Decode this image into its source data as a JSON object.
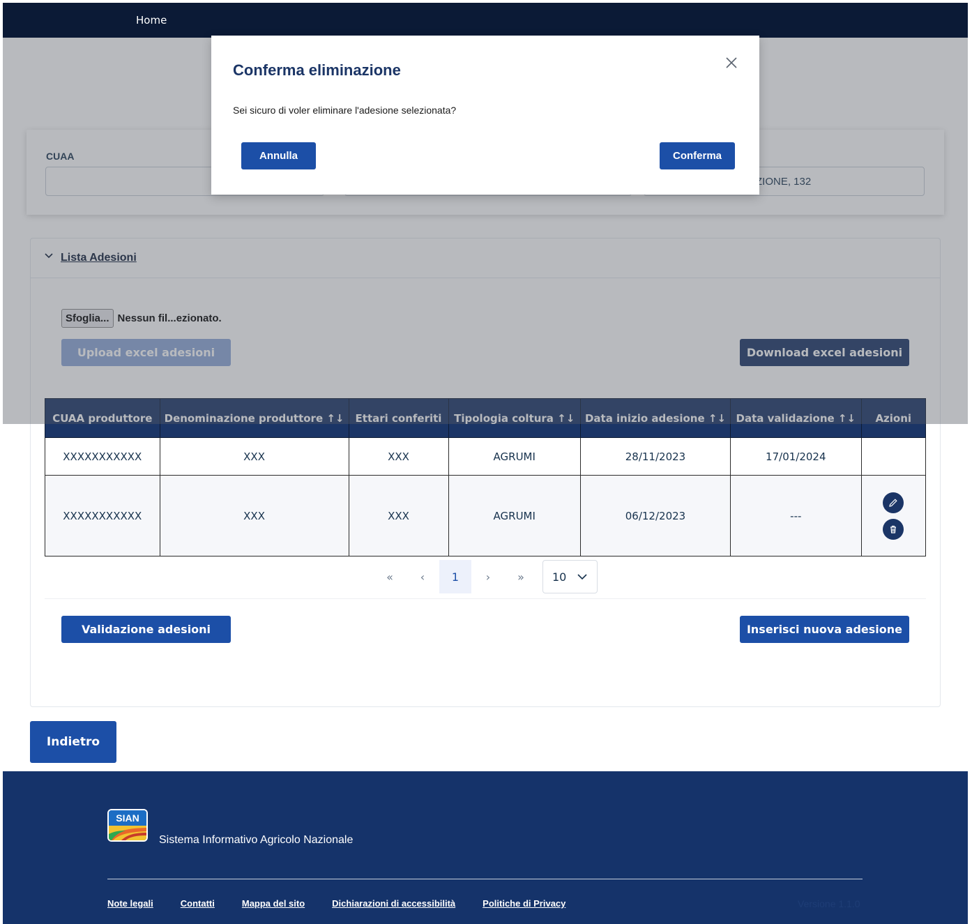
{
  "nav": {
    "home": "Home"
  },
  "filters": {
    "cuaa_label": "CUAA",
    "cuaa_value": "",
    "address_value": "ZIONE, 132"
  },
  "accordion": {
    "title": "Lista Adesioni"
  },
  "file_input": {
    "button": "Sfoglia...",
    "filename": "Nessun fil...ezionato."
  },
  "buttons": {
    "upload": "Upload excel adesioni",
    "download": "Download excel adesioni",
    "validate": "Validazione adesioni",
    "insert": "Inserisci nuova adesione",
    "back": "Indietro"
  },
  "table": {
    "headers": [
      "CUAA produttore",
      "Denominazione produttore ↑↓",
      "Ettari conferiti",
      "Tipologia coltura ↑↓",
      "Data inizio adesione ↑↓",
      "Data validazione ↑↓",
      "Azioni"
    ],
    "rows": [
      [
        "XXXXXXXXXXX",
        "XXX",
        "XXX",
        "AGRUMI",
        "28/11/2023",
        "17/01/2024",
        ""
      ],
      [
        "XXXXXXXXXXX",
        "XXX",
        "XXX",
        "AGRUMI",
        "06/12/2023",
        "---",
        ""
      ]
    ]
  },
  "pagination": {
    "first": "«",
    "prev": "‹",
    "current": "1",
    "next": "›",
    "last": "»",
    "page_size": "10"
  },
  "modal": {
    "title": "Conferma eliminazione",
    "message": "Sei sicuro di voler eliminare l'adesione selezionata?",
    "cancel": "Annulla",
    "confirm": "Conferma"
  },
  "footer": {
    "logo_text": "SIAN",
    "system_name": "Sistema Informativo Agricolo Nazionale",
    "links": [
      "Note legali",
      "Contatti",
      "Mappa del sito",
      "Dichiarazioni di accessibilità",
      "Politiche di Privacy"
    ],
    "version": "Versione 1.1.0"
  },
  "colors": {
    "primary": "#1c4fa7",
    "navy": "#1b3566",
    "footer": "#15336a"
  }
}
